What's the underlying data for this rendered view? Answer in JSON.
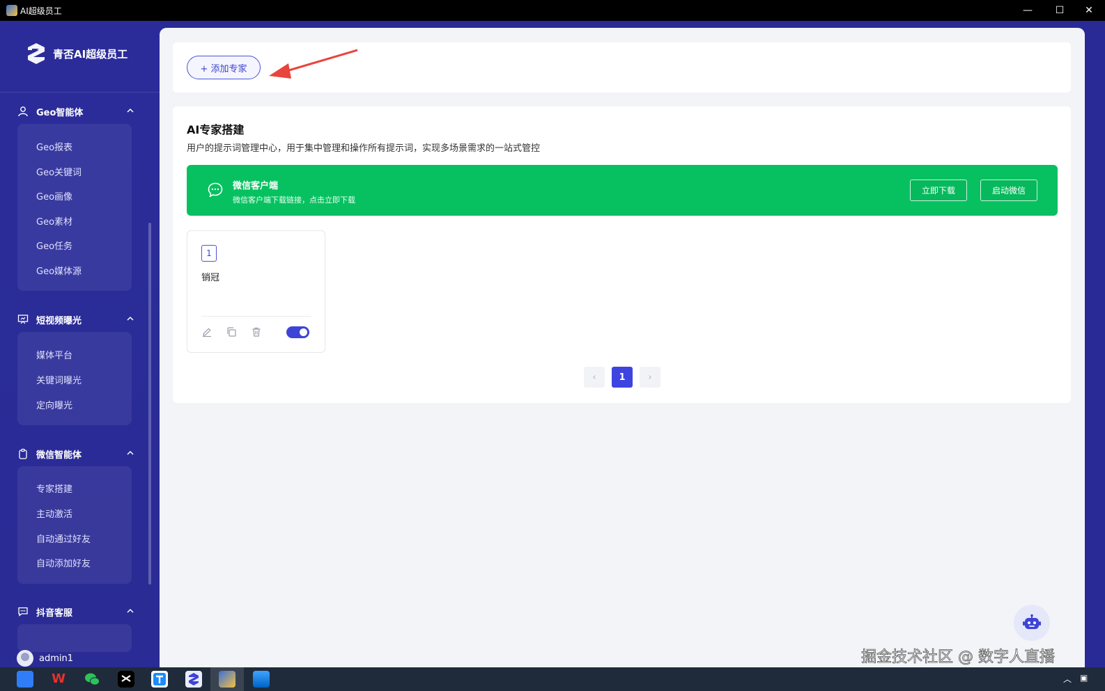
{
  "window": {
    "title": "AI超级员工",
    "minimize": "—",
    "maximize": "☐",
    "close": "✕"
  },
  "brand": {
    "name": "青否AI超级员工"
  },
  "sidebar": {
    "sections": [
      {
        "label": "Geo智能体",
        "icon": "user-icon",
        "items": [
          "Geo报表",
          "Geo关键词",
          "Geo画像",
          "Geo素材",
          "Geo任务",
          "Geo媒体源"
        ]
      },
      {
        "label": "短视频曝光",
        "icon": "presentation-icon",
        "items": [
          "媒体平台",
          "关键词曝光",
          "定向曝光"
        ]
      },
      {
        "label": "微信智能体",
        "icon": "clipboard-icon",
        "items": [
          "专家搭建",
          "主动激活",
          "自动通过好友",
          "自动添加好友"
        ]
      },
      {
        "label": "抖音客服",
        "icon": "chat-icon",
        "items": []
      }
    ],
    "user": "admin1"
  },
  "toolbar": {
    "add_expert": "+ 添加专家"
  },
  "page": {
    "title": "AI专家搭建",
    "description": "用户的提示词管理中心，用于集中管理和操作所有提示词，实现多场景需求的一站式管控"
  },
  "banner": {
    "title": "微信客户端",
    "subtitle": "微信客户端下载链接，点击立即下载",
    "download": "立即下载",
    "launch": "启动微信",
    "color": "#07c160"
  },
  "experts": [
    {
      "number": "1",
      "name": "销冠",
      "enabled": true
    }
  ],
  "pagination": {
    "prev": "‹",
    "current": "1",
    "next": "›"
  },
  "watermark": "掘金技术社区 @ 数字人直播",
  "colors": {
    "accent": "#3d44e0",
    "sidebar": "#2b2c9a",
    "annotation_arrow": "#e8453c"
  }
}
